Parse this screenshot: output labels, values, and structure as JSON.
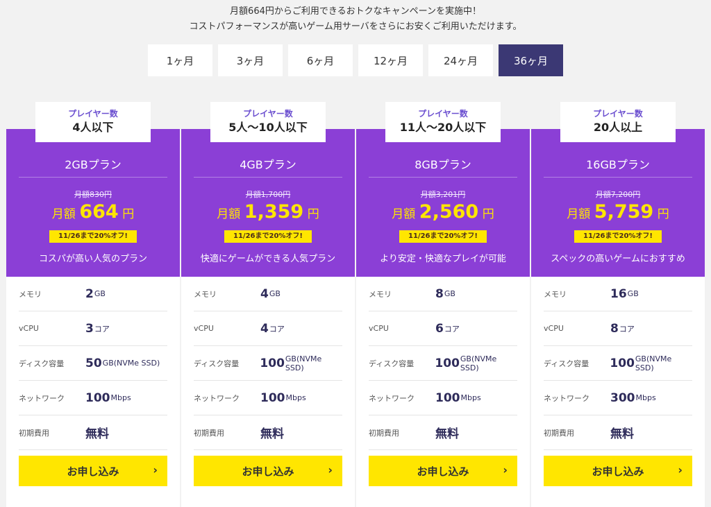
{
  "intro": {
    "line1": "月額664円からご利用できるおトクなキャンペーンを実施中！",
    "line2": "コストパフォーマンスが高いゲーム用サーバをさらにお安くご利用いただけます。"
  },
  "tabs": [
    "1ヶ月",
    "3ヶ月",
    "6ヶ月",
    "12ヶ月",
    "24ヶ月",
    "36ヶ月"
  ],
  "active_tab": "36ヶ月",
  "player_label": "プレイヤー数",
  "price_prefix": "月額",
  "price_unit": "円",
  "apply_label": "お申し込み",
  "spec_labels": {
    "memory": "メモリ",
    "vcpu": "vCPU",
    "disk": "ディスク容量",
    "network": "ネットワーク",
    "initial_fee": "初期費用"
  },
  "plans": [
    {
      "players": "4人以下",
      "name": "2GBプラン",
      "old_price": "月額830円",
      "price": "664",
      "sale": "11/26まで20%オフ!",
      "desc": "コスパが高い人気のプラン",
      "memory": "2",
      "memory_unit": "GB",
      "vcpu": "3",
      "vcpu_unit": "コア",
      "disk": "50",
      "disk_unit": "GB(NVMe SSD)",
      "network": "100",
      "network_unit": "Mbps",
      "initial_fee": "無料"
    },
    {
      "players": "5人〜10人以下",
      "name": "4GBプラン",
      "old_price": "月額1,700円",
      "price": "1,359",
      "sale": "11/26まで20%オフ!",
      "desc": "快適にゲームができる人気プラン",
      "memory": "4",
      "memory_unit": "GB",
      "vcpu": "4",
      "vcpu_unit": "コア",
      "disk": "100",
      "disk_unit": "GB(NVMe SSD)",
      "network": "100",
      "network_unit": "Mbps",
      "initial_fee": "無料"
    },
    {
      "players": "11人〜20人以下",
      "name": "8GBプラン",
      "old_price": "月額3,201円",
      "price": "2,560",
      "sale": "11/26まで20%オフ!",
      "desc": "より安定・快適なプレイが可能",
      "memory": "8",
      "memory_unit": "GB",
      "vcpu": "6",
      "vcpu_unit": "コア",
      "disk": "100",
      "disk_unit": "GB(NVMe SSD)",
      "network": "100",
      "network_unit": "Mbps",
      "initial_fee": "無料"
    },
    {
      "players": "20人以上",
      "name": "16GBプラン",
      "old_price": "月額7,200円",
      "price": "5,759",
      "sale": "11/26まで20%オフ!",
      "desc": "スペックの高いゲームにおすすめ",
      "memory": "16",
      "memory_unit": "GB",
      "vcpu": "8",
      "vcpu_unit": "コア",
      "disk": "100",
      "disk_unit": "GB(NVMe SSD)",
      "network": "300",
      "network_unit": "Mbps",
      "initial_fee": "無料"
    }
  ],
  "colors": {
    "accent_purple": "#8b3fd6",
    "active_tab": "#3b3874",
    "yellow": "#ffe600"
  },
  "icons": {
    "apply_chevron": "chevron-right-icon"
  }
}
